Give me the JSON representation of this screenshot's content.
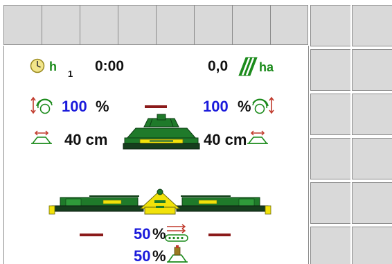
{
  "colors": {
    "softkey_bg": "#d9d9d9",
    "value_blue": "#1a1adb",
    "icon_green": "#1a8a1a",
    "machine_green": "#1f7a2a",
    "machine_yellow": "#f2e20a",
    "dash_red": "#8b1a1a"
  },
  "counters": {
    "hours_unit": "h",
    "hours_index": "1",
    "hours_value": "0:00",
    "area_value": "0,0",
    "area_unit": "ha"
  },
  "mower_front": {
    "left_pressure_value": "100",
    "left_pressure_unit": "%",
    "right_pressure_value": "100",
    "right_pressure_unit": "%",
    "left_width_value": "40 cm",
    "right_width_value": "40 cm"
  },
  "mower_rear": {
    "conveyor_value": "50",
    "conveyor_unit": "%",
    "lift_value": "50",
    "lift_unit": "%"
  },
  "icons": [
    "clock-icon",
    "area-icon",
    "pressure-left-icon",
    "pressure-right-icon",
    "width-left-icon",
    "width-right-icon",
    "front-mower-icon",
    "rear-mower-icon",
    "conveyor-icon",
    "lift-icon"
  ]
}
